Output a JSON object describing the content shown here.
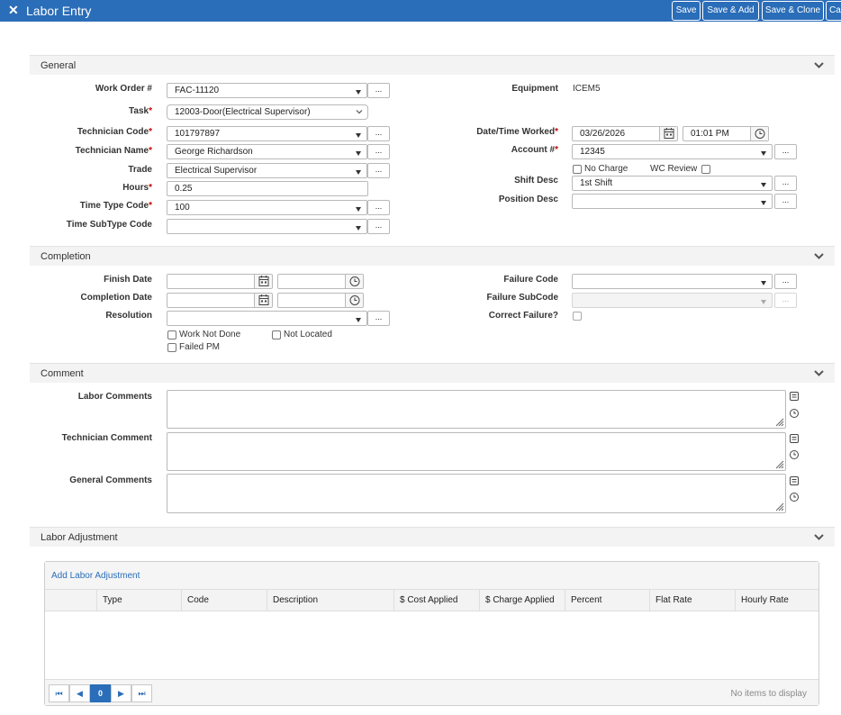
{
  "app": {
    "title": "Labor Entry"
  },
  "toolbar": {
    "save": "Save",
    "save_add": "Save & Add",
    "save_clone": "Save & Clone",
    "cancel": "Ca"
  },
  "general": {
    "header": "General",
    "work_order_label": "Work Order #",
    "work_order_value": "FAC-11120",
    "task_label": "Task",
    "task_value": "12003-Door(Electrical Supervisor)",
    "tech_code_label": "Technician Code",
    "tech_code_value": "101797897",
    "tech_name_label": "Technician Name",
    "tech_name_value": "George Richardson",
    "trade_label": "Trade",
    "trade_value": "Electrical Supervisor",
    "hours_label": "Hours",
    "hours_value": "0.25",
    "time_type_label": "Time Type Code",
    "time_type_value": "100",
    "time_subtype_label": "Time SubType Code",
    "time_subtype_value": "",
    "equipment_label": "Equipment",
    "equipment_value": "ICEM5",
    "date_worked_label": "Date/Time Worked",
    "date_value": "03/26/2026",
    "time_value": "01:01 PM",
    "account_label": "Account #",
    "account_value": "12345",
    "no_charge_label": "No Charge",
    "wc_review_label": "WC Review",
    "shift_label": "Shift Desc",
    "shift_value": "1st Shift",
    "position_label": "Position Desc",
    "position_value": "",
    "req_mark": "*",
    "ellipsis": "..."
  },
  "completion": {
    "header": "Completion",
    "finish_date_label": "Finish Date",
    "completion_date_label": "Completion Date",
    "resolution_label": "Resolution",
    "work_not_done_label": "Work Not Done",
    "not_located_label": "Not Located",
    "failed_pm_label": "Failed PM",
    "failure_code_label": "Failure Code",
    "failure_subcode_label": "Failure SubCode",
    "correct_failure_label": "Correct Failure?"
  },
  "comment": {
    "header": "Comment",
    "labor_comments_label": "Labor Comments",
    "technician_comment_label": "Technician Comment",
    "general_comments_label": "General Comments"
  },
  "labor_adjustment": {
    "header": "Labor Adjustment",
    "add_link": "Add Labor Adjustment",
    "columns": [
      "Type",
      "Code",
      "Description",
      "$ Cost Applied",
      "$ Charge Applied",
      "Percent",
      "Flat Rate",
      "Hourly Rate"
    ],
    "page_number": "0",
    "empty_text": "No items to display"
  },
  "colors": {
    "brand": "#2a6db8",
    "required": "#cc0000"
  },
  "icons": [
    "close-icon",
    "chevron-down-icon",
    "calendar-icon",
    "clock-icon",
    "spellcheck-icon",
    "history-icon",
    "resize-grip-icon",
    "first-page-icon",
    "prev-page-icon",
    "next-page-icon",
    "last-page-icon"
  ]
}
